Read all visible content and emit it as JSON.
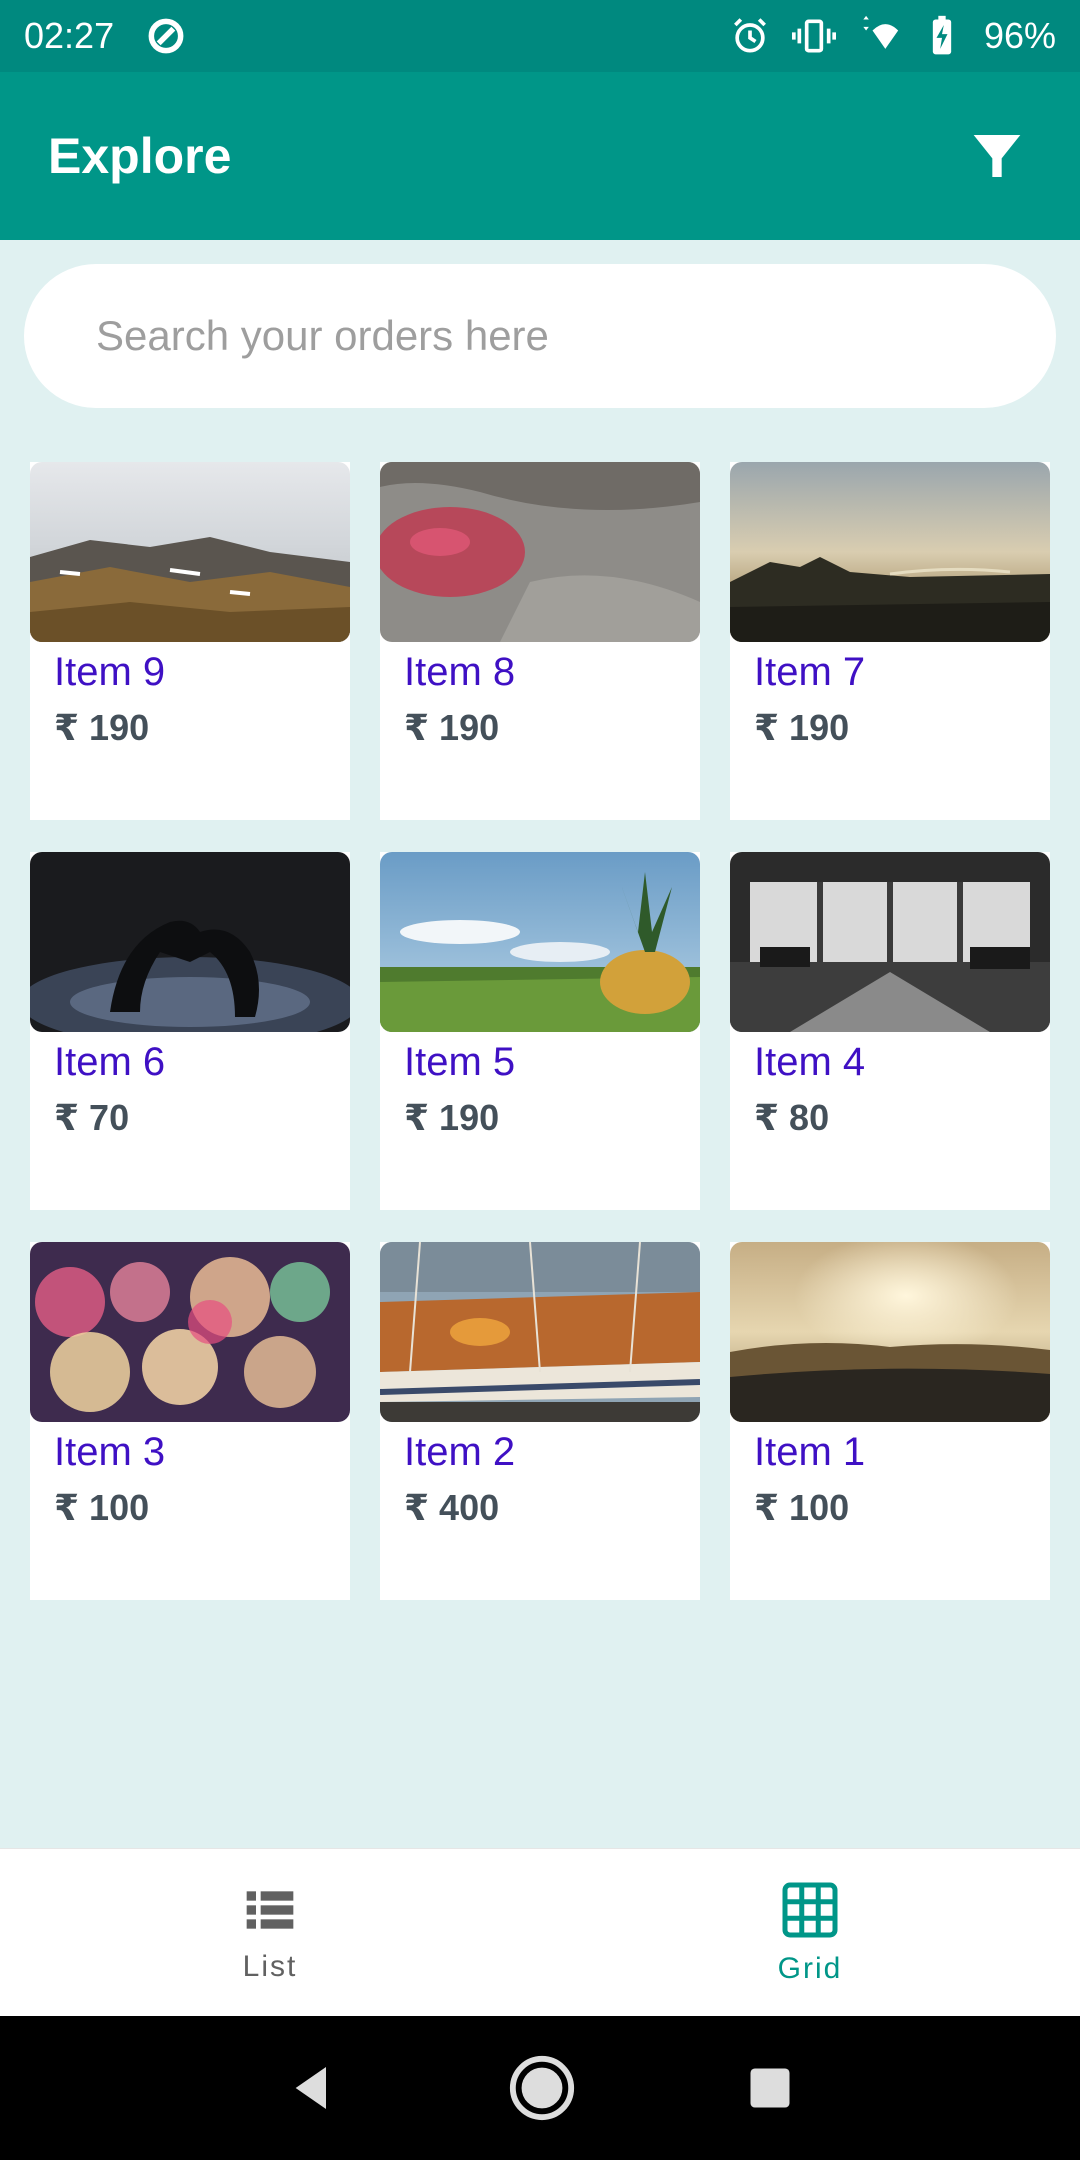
{
  "status_bar": {
    "time": "02:27",
    "battery": "96%"
  },
  "app_bar": {
    "title": "Explore"
  },
  "search": {
    "placeholder": "Search your orders here",
    "value": ""
  },
  "items": [
    {
      "name": "Item 9",
      "price": "₹ 190"
    },
    {
      "name": "Item 8",
      "price": "₹ 190"
    },
    {
      "name": "Item 7",
      "price": "₹ 190"
    },
    {
      "name": "Item 6",
      "price": "₹ 70"
    },
    {
      "name": "Item 5",
      "price": "₹ 190"
    },
    {
      "name": "Item 4",
      "price": "₹ 80"
    },
    {
      "name": "Item 3",
      "price": "₹ 100"
    },
    {
      "name": "Item 2",
      "price": "₹ 400"
    },
    {
      "name": "Item 1",
      "price": "₹ 100"
    }
  ],
  "bottom_nav": {
    "list_label": "List",
    "grid_label": "Grid",
    "active": "grid"
  },
  "colors": {
    "primary": "#009688",
    "status_bar": "#00897f",
    "background": "#e0f1f1",
    "item_name": "#3f10c4",
    "item_price": "#44505a"
  }
}
